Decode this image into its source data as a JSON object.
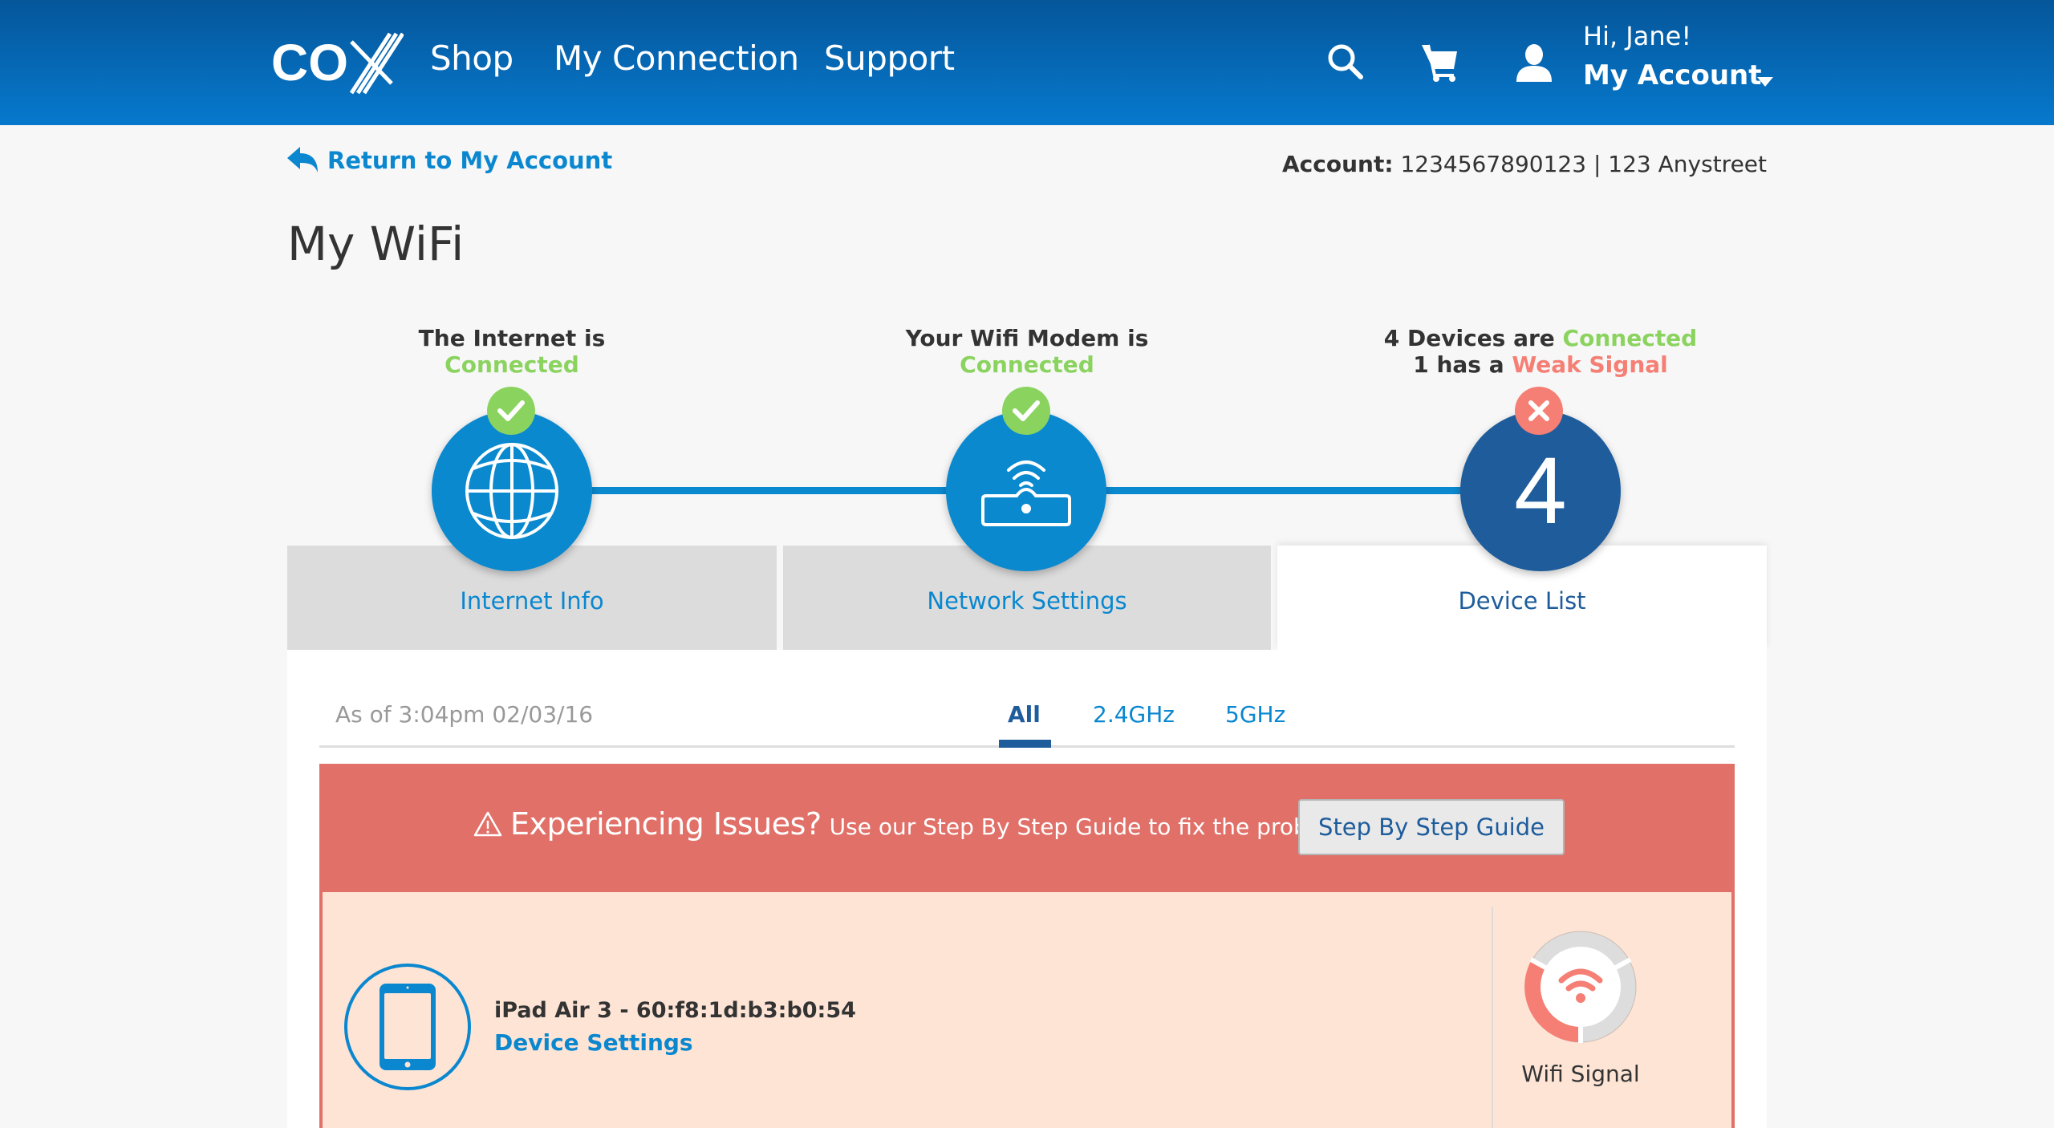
{
  "header": {
    "logo_alt": "COX",
    "nav": [
      "Shop",
      "My Connection",
      "Support"
    ],
    "icons": [
      "search-icon",
      "cart-icon",
      "user-icon"
    ],
    "greeting": "Hi, Jane!",
    "account_label": "My Account"
  },
  "subheader": {
    "return_link": "Return to My Account",
    "account_label": "Account:",
    "account_value": "1234567890123 | 123 Anystreet"
  },
  "page_title": "My WiFi",
  "steps": [
    {
      "line1": "The Internet is",
      "line2_status": "Connected",
      "status": "ok",
      "icon": "globe-icon",
      "tab_label": "Internet Info"
    },
    {
      "line1": "Your Wifi Modem is",
      "line2_status": "Connected",
      "status": "ok",
      "icon": "router-icon",
      "tab_label": "Network Settings"
    },
    {
      "line1_prefix": "4 Devices are",
      "line1_status": "Connected",
      "line2_prefix": "1 has a",
      "line2_status": "Weak Signal",
      "status": "error",
      "count": "4",
      "tab_label": "Device List",
      "active": true
    }
  ],
  "device_list": {
    "as_of": "As of 3:04pm 02/03/16",
    "filters": [
      {
        "label": "All",
        "active": true
      },
      {
        "label": "2.4GHz",
        "active": false
      },
      {
        "label": "5GHz",
        "active": false
      }
    ],
    "issues_banner": {
      "icon": "warning-icon",
      "title": "Experiencing Issues?",
      "text": "Use our Step By Step Guide to fix the problem.",
      "button": "Step By Step Guide"
    },
    "devices": [
      {
        "name": "iPad Air 3 - 60:f8:1d:b3:b0:54",
        "link": "Device Settings",
        "icon": "tablet-icon",
        "signal_label": "Wifi Signal",
        "signal_level": "1 of 3",
        "signal_status": "weak"
      }
    ]
  },
  "colors": {
    "header_blue": "#0679cd",
    "accent_blue": "#0a87cf",
    "dark_blue": "#1e5c9b",
    "success_green": "#8bd35f",
    "error_red": "#f57f74",
    "banner_red": "#e07068",
    "row_bg": "#fde4d5"
  }
}
